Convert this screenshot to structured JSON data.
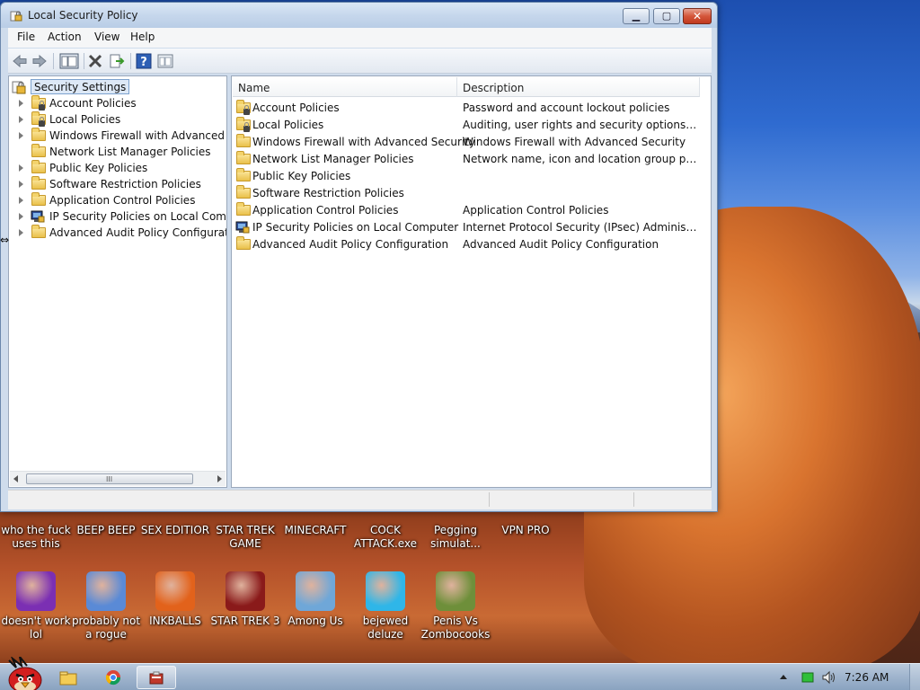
{
  "window": {
    "title": "Local Security Policy",
    "menu": [
      "File",
      "Action",
      "View",
      "Help"
    ]
  },
  "tree": {
    "root": "Security Settings",
    "items": [
      {
        "label": "Account Policies",
        "icon": "folder-lock-icon"
      },
      {
        "label": "Local Policies",
        "icon": "folder-lock-icon"
      },
      {
        "label": "Windows Firewall with Advanced Security",
        "icon": "folder-icon"
      },
      {
        "label": "Network List Manager Policies",
        "icon": "folder-icon"
      },
      {
        "label": "Public Key Policies",
        "icon": "folder-icon"
      },
      {
        "label": "Software Restriction Policies",
        "icon": "folder-icon"
      },
      {
        "label": "Application Control Policies",
        "icon": "folder-icon"
      },
      {
        "label": "IP Security Policies on Local Computer",
        "icon": "ip-security-icon"
      },
      {
        "label": "Advanced Audit Policy Configuration",
        "icon": "folder-icon"
      }
    ],
    "scroll_grip": "III"
  },
  "list": {
    "columns": [
      "Name",
      "Description"
    ],
    "rows": [
      {
        "name": "Account Policies",
        "desc": "Password and account lockout policies"
      },
      {
        "name": "Local Policies",
        "desc": "Auditing, user rights and security options polici..."
      },
      {
        "name": "Windows Firewall with Advanced Security",
        "desc": "Windows Firewall with Advanced Security"
      },
      {
        "name": "Network List Manager Policies",
        "desc": "Network name, icon and location group policies."
      },
      {
        "name": "Public Key Policies",
        "desc": ""
      },
      {
        "name": "Software Restriction Policies",
        "desc": ""
      },
      {
        "name": "Application Control Policies",
        "desc": "Application Control Policies"
      },
      {
        "name": "IP Security Policies on Local Computer",
        "desc": "Internet Protocol Security (IPsec) Administratio..."
      },
      {
        "name": "Advanced Audit Policy Configuration",
        "desc": "Advanced Audit Policy Configuration"
      }
    ]
  },
  "desktop": {
    "top_labels": [
      {
        "line1": "who the fuck",
        "line2": "uses this"
      },
      {
        "line1": "BEEP BEEP",
        "line2": ""
      },
      {
        "line1": "SEX EDITIOR",
        "line2": ""
      },
      {
        "line1": "STAR TREK",
        "line2": "GAME"
      },
      {
        "line1": "MINECRAFT",
        "line2": ""
      },
      {
        "line1": "COCK",
        "line2": "ATTACK.exe"
      },
      {
        "line1": "Pegging",
        "line2": "simulat..."
      },
      {
        "line1": "VPN PRO",
        "line2": ""
      }
    ],
    "icons": [
      {
        "line1": "doesn't work",
        "line2": "lol",
        "color": "#7b2fb3"
      },
      {
        "line1": "probably not",
        "line2": "a rogue",
        "color": "#5a8ad6"
      },
      {
        "line1": "INKBALLS",
        "line2": "",
        "color": "#e2621b"
      },
      {
        "line1": "STAR TREK 3",
        "line2": "",
        "color": "#8a1a1a"
      },
      {
        "line1": "Among Us",
        "line2": "",
        "color": "#6fa7d8"
      },
      {
        "line1": "bejewed",
        "line2": "deluze",
        "color": "#2fb6e8"
      },
      {
        "line1": "Penis Vs",
        "line2": "Zombocooks",
        "color": "#6e8f3a"
      }
    ]
  },
  "taskbar": {
    "clock": "7:26 AM"
  }
}
